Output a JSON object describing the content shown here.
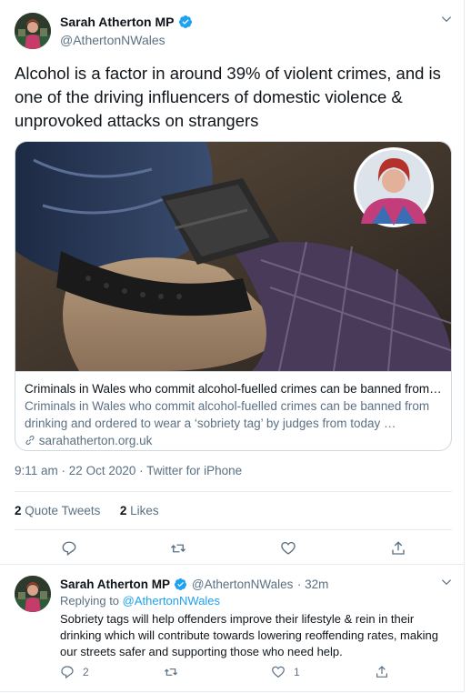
{
  "tweet": {
    "author_name": "Sarah Atherton MP",
    "author_handle": "@AthertonNWales",
    "text": "Alcohol is a factor in around 39% of violent crimes, and is one of the driving influencers of domestic violence & unprovoked attacks on strangers",
    "card": {
      "title": "Criminals in Wales who commit alcohol-fuelled crimes can be banned from…",
      "description": "Criminals in Wales who commit alcohol-fuelled crimes can be banned from drinking and ordered to wear a ‘sobriety tag’ by judges from today …",
      "domain": "sarahatherton.org.uk"
    },
    "time": "9:11 am",
    "date": "22 Oct 2020",
    "source": "Twitter for iPhone",
    "quote_tweets_count": "2",
    "quote_tweets_label": "Quote Tweets",
    "likes_count": "2",
    "likes_label": "Likes"
  },
  "reply": {
    "author_name": "Sarah Atherton MP",
    "author_handle": "@AthertonNWales",
    "age": "32m",
    "replying_prefix": "Replying to",
    "replying_to": "@AthertonNWales",
    "text": "Sobriety tags will help offenders improve their lifestyle & rein in their drinking which will contribute towards lowering reoffending rates, making our streets safer and supporting those who need help.",
    "reply_count": "2",
    "like_count": "1"
  },
  "icons": {
    "verified": "verified-badge-icon",
    "more": "chevron-down-icon",
    "reply": "reply-icon",
    "retweet": "retweet-icon",
    "like": "heart-icon",
    "share": "share-icon",
    "link": "link-icon"
  },
  "colors": {
    "brand_blue": "#1da1f2",
    "secondary_text": "#5b7083",
    "border": "#cfd9de"
  }
}
